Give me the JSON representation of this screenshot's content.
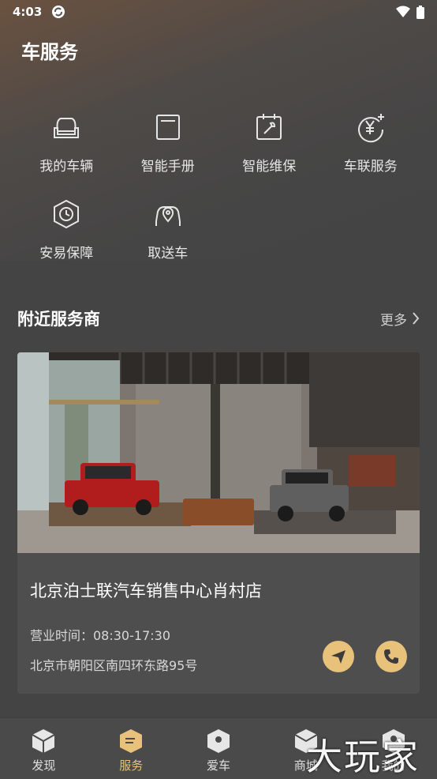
{
  "status_bar": {
    "time": "4:03",
    "icons": [
      "app-sync-icon",
      "wifi-icon",
      "battery-icon"
    ]
  },
  "page": {
    "title": "车服务"
  },
  "services": [
    {
      "label": "我的车辆",
      "icon": "car-seat-icon"
    },
    {
      "label": "智能手册",
      "icon": "manual-icon"
    },
    {
      "label": "智能维保",
      "icon": "maintenance-calendar-icon"
    },
    {
      "label": "车联服务",
      "icon": "yuan-sparkle-icon"
    },
    {
      "label": "安易保障",
      "icon": "shield-clock-icon"
    },
    {
      "label": "取送车",
      "icon": "car-location-icon"
    }
  ],
  "nearby": {
    "title": "附近服务商",
    "more_label": "更多",
    "dealer": {
      "name": "北京泊士联汽车销售中心肖村店",
      "hours": "营业时间：08:30-17:30",
      "address": "北京市朝阳区南四环东路95号",
      "photo": "showroom-photo"
    }
  },
  "tabs": [
    {
      "label": "发现",
      "icon": "cube-icon",
      "active": false
    },
    {
      "label": "服务",
      "icon": "service-box-icon",
      "active": true
    },
    {
      "label": "爱车",
      "icon": "car-pin-icon",
      "active": false
    },
    {
      "label": "商城",
      "icon": "shop-box-icon",
      "active": false
    },
    {
      "label": "我的",
      "icon": "profile-icon",
      "active": false
    }
  ],
  "watermark": "大玩家",
  "colors": {
    "accent": "#e8c27a",
    "background": "#444444",
    "card": "#4e4e4e"
  }
}
